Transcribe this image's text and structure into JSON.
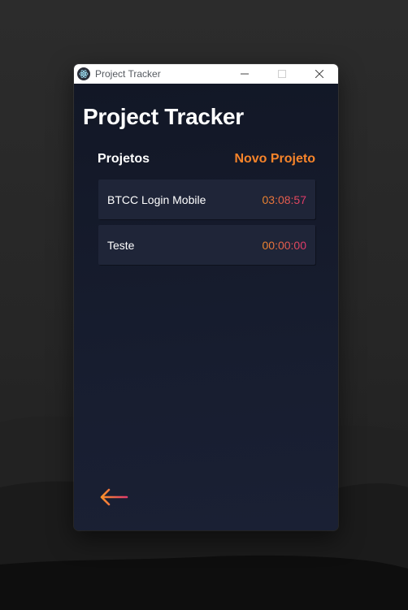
{
  "window": {
    "title": "Project Tracker"
  },
  "app": {
    "title": "Project Tracker",
    "section_label": "Projetos",
    "new_project_label": "Novo Projeto"
  },
  "projects": [
    {
      "name": "BTCC Login Mobile",
      "time": "03:08:57"
    },
    {
      "name": "Teste",
      "time": "00:00:00"
    }
  ],
  "colors": {
    "accent_orange": "#f7842a",
    "accent_pink": "#e0356e",
    "background": "#141a2b",
    "card": "#1f2538"
  },
  "icons": {
    "app": "electron-icon",
    "minimize": "minimize-icon",
    "maximize": "maximize-icon",
    "close": "close-icon",
    "back": "arrow-left-icon"
  }
}
